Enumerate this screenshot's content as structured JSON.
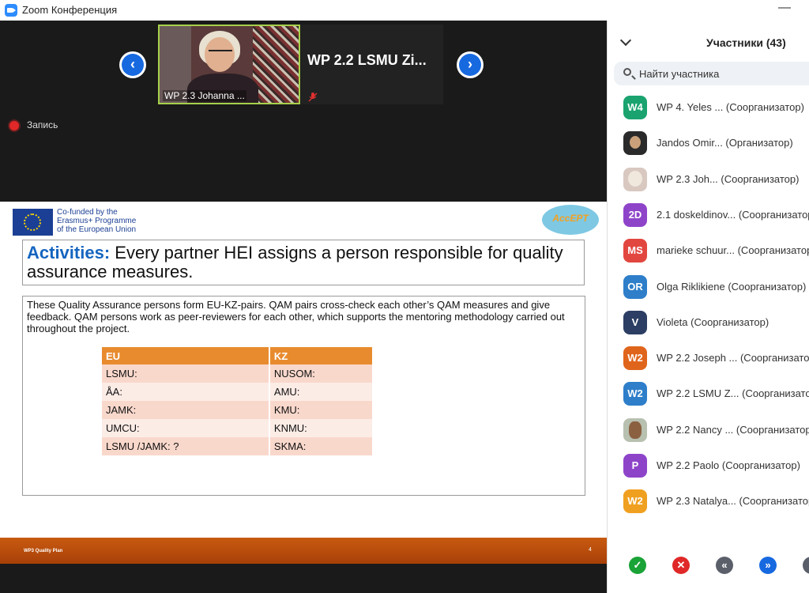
{
  "window": {
    "title": "Zoom Конференция",
    "minimize_glyph": "—"
  },
  "video": {
    "tile1_name": "WP 2.3 Johanna ...",
    "tile2_name": "WP 2.2 LSMU Zi...",
    "prev_glyph": "‹",
    "next_glyph": "›",
    "recording_label": "Запись",
    "icons": [
      "zoom-logo-icon",
      "chevron-left-icon",
      "chevron-right-icon",
      "mic-muted-icon",
      "recording-icon"
    ]
  },
  "slide": {
    "eu_text": [
      "Co-funded by the",
      "Erasmus+ Programme",
      "of the European Union"
    ],
    "logo_text": "AccEPT",
    "activities_label": "Activities:",
    "activities_text": " Every partner HEI assigns a person responsible for quality assurance measures.",
    "paragraph": "These Quality Assurance persons form EU-KZ-pairs. QAM pairs cross-check each other’s QAM measures and give feedback. QAM persons work as peer-reviewers for each other, which supports the mentoring methodology carried out throughout the project.",
    "table": {
      "headers": [
        "EU",
        "KZ"
      ],
      "rows": [
        [
          "LSMU:",
          "NUSOM:"
        ],
        [
          "ÅA:",
          "AMU:"
        ],
        [
          "JAMK:",
          "KMU:"
        ],
        [
          "UMCU:",
          "KNMU:"
        ],
        [
          "LSMU /JAMK: ?",
          "SKMA:"
        ]
      ]
    },
    "footer_text": "WP3 Quality Plan",
    "page_number": "4",
    "colors": {
      "heading": "#1565c0",
      "table_header": "#e88b2e",
      "footer": "#b84a0c"
    }
  },
  "participants": {
    "title": "Участники (43)",
    "search_placeholder": "Найти участника",
    "items": [
      {
        "initials": "W4",
        "color": "#1aa36f",
        "name": "WP 4. Yeles ...",
        "role": "(Соорганизатор)"
      },
      {
        "initials": "",
        "color": "#2a2a2a",
        "name": "Jandos Omir...",
        "role": "(Организатор)"
      },
      {
        "initials": "",
        "color": "#d8c8c0",
        "name": "WP 2.3 Joh...",
        "role": "(Соорганизатор)"
      },
      {
        "initials": "2D",
        "color": "#8e44c9",
        "name": "2.1 doskeldinov...",
        "role": "(Соорганизатор)"
      },
      {
        "initials": "MS",
        "color": "#e2473f",
        "name": "marieke schuur...",
        "role": "(Соорганизатор)"
      },
      {
        "initials": "OR",
        "color": "#2e7ec9",
        "name": "Olga Riklikiene",
        "role": "(Соорганизатор)"
      },
      {
        "initials": "V",
        "color": "#2c3e63",
        "name": "Violeta",
        "role": "(Соорганизатор)"
      },
      {
        "initials": "W2",
        "color": "#e0651c",
        "name": "WP 2.2 Joseph ...",
        "role": "(Соорганизатор)"
      },
      {
        "initials": "W2",
        "color": "#2e7ec9",
        "name": "WP 2.2 LSMU Z...",
        "role": "(Соорганизатор)"
      },
      {
        "initials": "",
        "color": "#b8c0b0",
        "name": "WP 2.2 Nancy ...",
        "role": "(Соорганизатор)"
      },
      {
        "initials": "P",
        "color": "#8e44c9",
        "name": "WP 2.2 Paolo",
        "role": "(Соорганизатор)"
      },
      {
        "initials": "W2",
        "color": "#f0a020",
        "name": "WP 2.3 Natalya...",
        "role": "(Соорганизатор)"
      }
    ],
    "bottom_icons": [
      {
        "name": "check-icon",
        "glyph": "✓",
        "color": "#1aa336"
      },
      {
        "name": "close-icon",
        "glyph": "✕",
        "color": "#e02828"
      },
      {
        "name": "rewind-icon",
        "glyph": "«",
        "color": "#5a5f6a"
      },
      {
        "name": "fast-forward-icon",
        "glyph": "»",
        "color": "#1769e0"
      },
      {
        "name": "more-icon",
        "glyph": "•",
        "color": "#5a5f6a"
      }
    ]
  }
}
